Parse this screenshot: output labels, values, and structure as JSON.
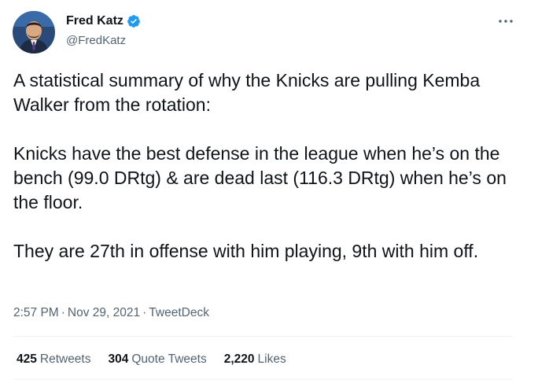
{
  "author": {
    "display_name": "Fred Katz",
    "handle": "@FredKatz",
    "verified": true,
    "verified_color": "#1d9bf0"
  },
  "tweet": {
    "paragraphs": [
      "A statistical summary of why the Knicks are pulling Kemba Walker from the rotation:",
      "Knicks have the best defense in the league when he’s on the bench (99.0 DRtg) & are dead last (116.3 DRtg) when he’s on the floor.",
      "They are 27th in offense with him playing, 9th with him off."
    ],
    "time": "2:57 PM",
    "date": "Nov 29, 2021",
    "source": "TweetDeck",
    "separator": "·"
  },
  "stats": {
    "retweets_count": "425",
    "retweets_label": "Retweets",
    "quotes_count": "304",
    "quotes_label": "Quote Tweets",
    "likes_count": "2,220",
    "likes_label": "Likes"
  },
  "icons": {
    "more": "more-options-icon",
    "verified": "verified-badge-icon"
  }
}
